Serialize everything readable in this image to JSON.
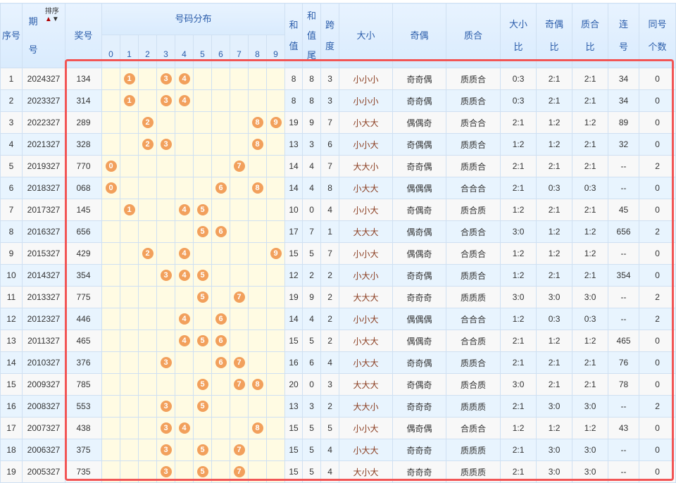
{
  "headers": {
    "index": "序号",
    "period": "期号",
    "sort_label": "排序",
    "prize": "奖号",
    "distribution": "号码分布",
    "digits": [
      "0",
      "1",
      "2",
      "3",
      "4",
      "5",
      "6",
      "7",
      "8",
      "9"
    ],
    "sum": "和值",
    "sum_tail": "和值尾",
    "span": "跨度",
    "big_small": "大小",
    "odd_even": "奇偶",
    "prime_comp": "质合",
    "big_small_ratio": "大小比",
    "odd_even_ratio": "奇偶比",
    "prime_comp_ratio": "质合比",
    "consecutive": "连号",
    "same_count": "同号个数"
  },
  "colors": {
    "ball": "#f2a05c",
    "frame": "#f25555",
    "header_text": "#2a5caa"
  },
  "rows": [
    {
      "idx": "1",
      "period": "2024327",
      "prize": "134",
      "balls": [
        1,
        3,
        4
      ],
      "sum": "8",
      "tail": "8",
      "span": "3",
      "bs": "小小小",
      "oe": "奇奇偶",
      "pc": "质质合",
      "bsr": "0:3",
      "oer": "2:1",
      "pcr": "2:1",
      "cons": "34",
      "same": "0"
    },
    {
      "idx": "2",
      "period": "2023327",
      "prize": "314",
      "balls": [
        1,
        3,
        4
      ],
      "sum": "8",
      "tail": "8",
      "span": "3",
      "bs": "小小小",
      "oe": "奇奇偶",
      "pc": "质质合",
      "bsr": "0:3",
      "oer": "2:1",
      "pcr": "2:1",
      "cons": "34",
      "same": "0"
    },
    {
      "idx": "3",
      "period": "2022327",
      "prize": "289",
      "balls": [
        2,
        8,
        9
      ],
      "sum": "19",
      "tail": "9",
      "span": "7",
      "bs": "小大大",
      "oe": "偶偶奇",
      "pc": "质合合",
      "bsr": "2:1",
      "oer": "1:2",
      "pcr": "1:2",
      "cons": "89",
      "same": "0"
    },
    {
      "idx": "4",
      "period": "2021327",
      "prize": "328",
      "balls": [
        2,
        3,
        8
      ],
      "sum": "13",
      "tail": "3",
      "span": "6",
      "bs": "小小大",
      "oe": "奇偶偶",
      "pc": "质质合",
      "bsr": "1:2",
      "oer": "1:2",
      "pcr": "2:1",
      "cons": "32",
      "same": "0"
    },
    {
      "idx": "5",
      "period": "2019327",
      "prize": "770",
      "balls": [
        0,
        7
      ],
      "sum": "14",
      "tail": "4",
      "span": "7",
      "bs": "大大小",
      "oe": "奇奇偶",
      "pc": "质质合",
      "bsr": "2:1",
      "oer": "2:1",
      "pcr": "2:1",
      "cons": "--",
      "same": "2"
    },
    {
      "idx": "6",
      "period": "2018327",
      "prize": "068",
      "balls": [
        0,
        6,
        8
      ],
      "sum": "14",
      "tail": "4",
      "span": "8",
      "bs": "小大大",
      "oe": "偶偶偶",
      "pc": "合合合",
      "bsr": "2:1",
      "oer": "0:3",
      "pcr": "0:3",
      "cons": "--",
      "same": "0"
    },
    {
      "idx": "7",
      "period": "2017327",
      "prize": "145",
      "balls": [
        1,
        4,
        5
      ],
      "sum": "10",
      "tail": "0",
      "span": "4",
      "bs": "小小大",
      "oe": "奇偶奇",
      "pc": "质合质",
      "bsr": "1:2",
      "oer": "2:1",
      "pcr": "2:1",
      "cons": "45",
      "same": "0"
    },
    {
      "idx": "8",
      "period": "2016327",
      "prize": "656",
      "balls": [
        5,
        6
      ],
      "sum": "17",
      "tail": "7",
      "span": "1",
      "bs": "大大大",
      "oe": "偶奇偶",
      "pc": "合质合",
      "bsr": "3:0",
      "oer": "1:2",
      "pcr": "1:2",
      "cons": "656",
      "same": "2"
    },
    {
      "idx": "9",
      "period": "2015327",
      "prize": "429",
      "balls": [
        2,
        4,
        9
      ],
      "sum": "15",
      "tail": "5",
      "span": "7",
      "bs": "小小大",
      "oe": "偶偶奇",
      "pc": "合质合",
      "bsr": "1:2",
      "oer": "1:2",
      "pcr": "1:2",
      "cons": "--",
      "same": "0"
    },
    {
      "idx": "10",
      "period": "2014327",
      "prize": "354",
      "balls": [
        3,
        4,
        5
      ],
      "sum": "12",
      "tail": "2",
      "span": "2",
      "bs": "小大小",
      "oe": "奇奇偶",
      "pc": "质质合",
      "bsr": "1:2",
      "oer": "2:1",
      "pcr": "2:1",
      "cons": "354",
      "same": "0"
    },
    {
      "idx": "11",
      "period": "2013327",
      "prize": "775",
      "balls": [
        5,
        7
      ],
      "sum": "19",
      "tail": "9",
      "span": "2",
      "bs": "大大大",
      "oe": "奇奇奇",
      "pc": "质质质",
      "bsr": "3:0",
      "oer": "3:0",
      "pcr": "3:0",
      "cons": "--",
      "same": "2"
    },
    {
      "idx": "12",
      "period": "2012327",
      "prize": "446",
      "balls": [
        4,
        6
      ],
      "sum": "14",
      "tail": "4",
      "span": "2",
      "bs": "小小大",
      "oe": "偶偶偶",
      "pc": "合合合",
      "bsr": "1:2",
      "oer": "0:3",
      "pcr": "0:3",
      "cons": "--",
      "same": "2"
    },
    {
      "idx": "13",
      "period": "2011327",
      "prize": "465",
      "balls": [
        4,
        5,
        6
      ],
      "sum": "15",
      "tail": "5",
      "span": "2",
      "bs": "小大大",
      "oe": "偶偶奇",
      "pc": "合合质",
      "bsr": "2:1",
      "oer": "1:2",
      "pcr": "1:2",
      "cons": "465",
      "same": "0"
    },
    {
      "idx": "14",
      "period": "2010327",
      "prize": "376",
      "balls": [
        3,
        6,
        7
      ],
      "sum": "16",
      "tail": "6",
      "span": "4",
      "bs": "小大大",
      "oe": "奇奇偶",
      "pc": "质质合",
      "bsr": "2:1",
      "oer": "2:1",
      "pcr": "2:1",
      "cons": "76",
      "same": "0"
    },
    {
      "idx": "15",
      "period": "2009327",
      "prize": "785",
      "balls": [
        5,
        7,
        8
      ],
      "sum": "20",
      "tail": "0",
      "span": "3",
      "bs": "大大大",
      "oe": "奇偶奇",
      "pc": "质合质",
      "bsr": "3:0",
      "oer": "2:1",
      "pcr": "2:1",
      "cons": "78",
      "same": "0"
    },
    {
      "idx": "16",
      "period": "2008327",
      "prize": "553",
      "balls": [
        3,
        5
      ],
      "sum": "13",
      "tail": "3",
      "span": "2",
      "bs": "大大小",
      "oe": "奇奇奇",
      "pc": "质质质",
      "bsr": "2:1",
      "oer": "3:0",
      "pcr": "3:0",
      "cons": "--",
      "same": "2"
    },
    {
      "idx": "17",
      "period": "2007327",
      "prize": "438",
      "balls": [
        3,
        4,
        8
      ],
      "sum": "15",
      "tail": "5",
      "span": "5",
      "bs": "小小大",
      "oe": "偶奇偶",
      "pc": "合质合",
      "bsr": "1:2",
      "oer": "1:2",
      "pcr": "1:2",
      "cons": "43",
      "same": "0"
    },
    {
      "idx": "18",
      "period": "2006327",
      "prize": "375",
      "balls": [
        3,
        5,
        7
      ],
      "sum": "15",
      "tail": "5",
      "span": "4",
      "bs": "小大大",
      "oe": "奇奇奇",
      "pc": "质质质",
      "bsr": "2:1",
      "oer": "3:0",
      "pcr": "3:0",
      "cons": "--",
      "same": "0"
    },
    {
      "idx": "19",
      "period": "2005327",
      "prize": "735",
      "balls": [
        3,
        5,
        7
      ],
      "sum": "15",
      "tail": "5",
      "span": "4",
      "bs": "大小大",
      "oe": "奇奇奇",
      "pc": "质质质",
      "bsr": "2:1",
      "oer": "3:0",
      "pcr": "3:0",
      "cons": "--",
      "same": "0"
    }
  ]
}
